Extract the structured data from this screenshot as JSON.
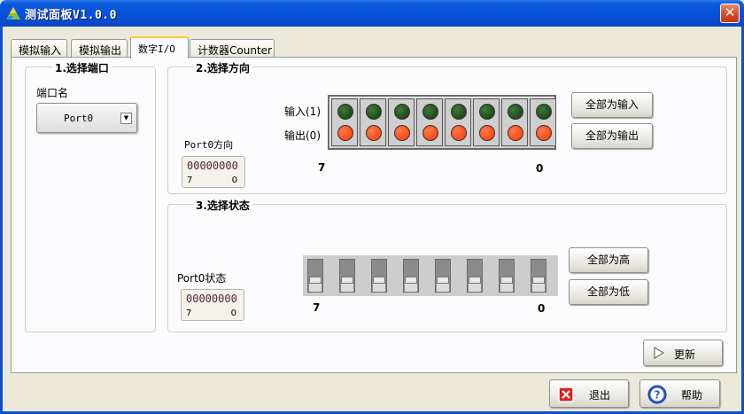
{
  "window": {
    "title": "测试面板V1.0.0",
    "close_label": "✕"
  },
  "tabs": [
    {
      "label": "模拟输入"
    },
    {
      "label": "模拟输出"
    },
    {
      "label": "数字I/O"
    },
    {
      "label": "计数器Counter"
    }
  ],
  "port_group": {
    "title": "1.选择端口",
    "label": "端口名",
    "selected": "Port0"
  },
  "direction_group": {
    "title": "2.选择方向",
    "port_label": "Port0方向",
    "readout": {
      "value": "00000000",
      "hi": "7",
      "lo": "0"
    },
    "input_label": "输入(1)",
    "output_label": "输出(0)",
    "bit_hi": "7",
    "bit_lo": "0",
    "all_input_label": "全部为输入",
    "all_output_label": "全部为输出",
    "colors": {
      "input_led": "#1e4a1c",
      "output_led": "#ff4a12"
    }
  },
  "state_group": {
    "title": "3.选择状态",
    "port_label": "Port0状态",
    "readout": {
      "value": "00000000",
      "hi": "7",
      "lo": "0"
    },
    "bit_hi": "7",
    "bit_lo": "0",
    "all_high_label": "全部为高",
    "all_low_label": "全部为低"
  },
  "actions": {
    "refresh_label": "更新",
    "exit_label": "退出",
    "help_label": "帮助"
  }
}
